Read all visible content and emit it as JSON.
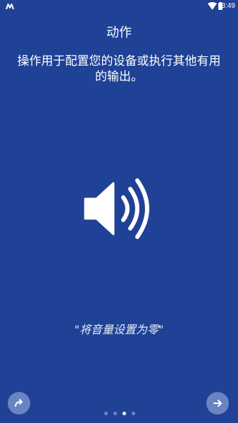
{
  "status_bar": {
    "time": "3:49",
    "icons": [
      "app-logo-icon",
      "wifi-icon",
      "battery-icon"
    ]
  },
  "intro": {
    "title": "动作",
    "description": "操作用于配置您的设备或执行其他有用的输出。",
    "illustration_icon": "volume-up-icon",
    "example_command": "\"将音量设置为零\""
  },
  "navigation": {
    "skip_icon": "redo-arrow-icon",
    "next_icon": "arrow-right-icon",
    "page_count": 4,
    "current_page": 3
  },
  "colors": {
    "background": "#1f4196",
    "button": "#6a84c2",
    "dot_inactive": "#7086bd",
    "dot_active": "#ffffff"
  }
}
